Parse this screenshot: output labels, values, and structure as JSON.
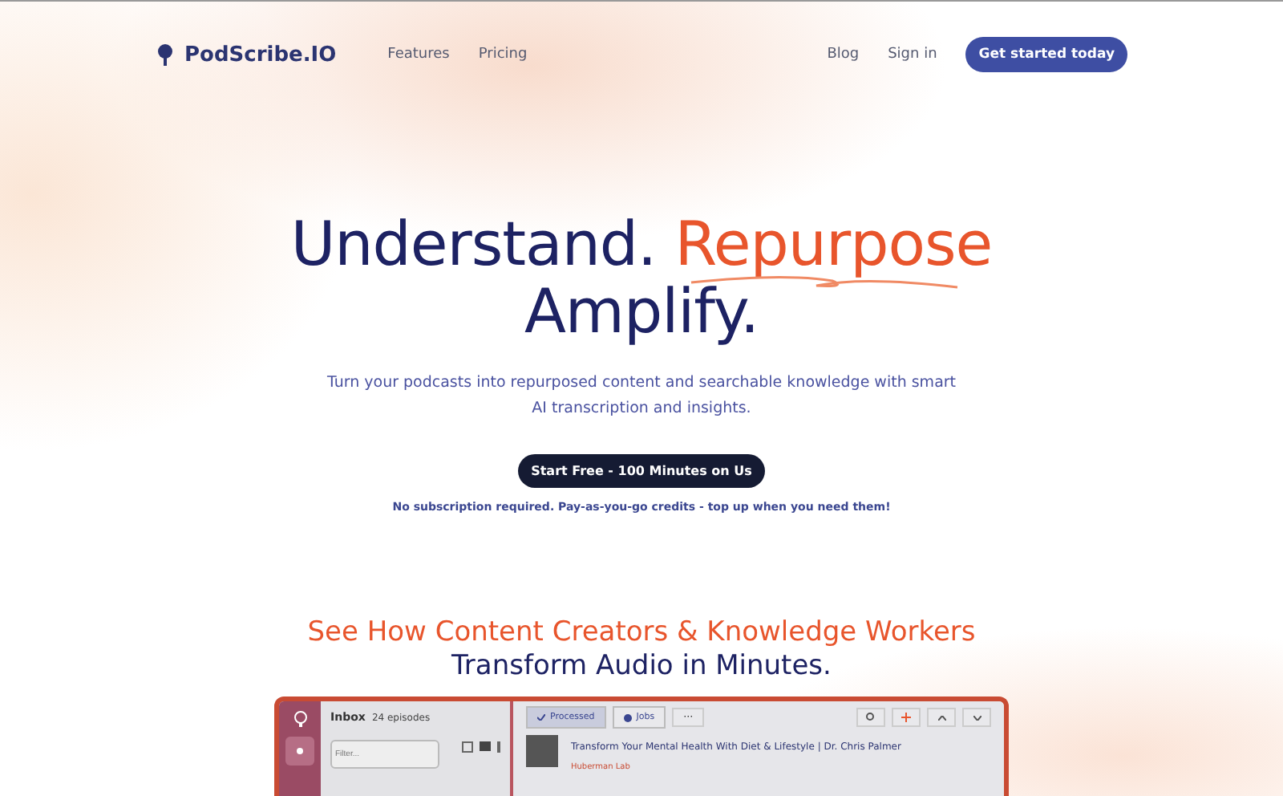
{
  "nav": {
    "brand": "PodScribe.IO",
    "links": [
      "Features",
      "Pricing"
    ],
    "right_links": [
      "Blog",
      "Sign in"
    ],
    "cta": "Get started today"
  },
  "hero": {
    "title_start": "Understand.",
    "title_accent": "Repurpose",
    "title_end": "Amplify.",
    "subtitle": "Turn your podcasts into repurposed content and searchable knowledge with smart AI transcription and insights.",
    "button": "Start Free - 100 Minutes on Us",
    "note": "No subscription required. Pay-as-you-go credits - top up when you need them!"
  },
  "section": {
    "heading_accent": "See How Content Creators & Knowledge Workers",
    "heading_rest": "Transform Audio in Minutes."
  },
  "app": {
    "inbox_title": "Inbox",
    "inbox_count": "24 episodes",
    "filter_placeholder": "Filter...",
    "tabs": [
      {
        "label": "Processed",
        "selected": true
      },
      {
        "label": "Jobs",
        "selected": false
      }
    ],
    "more": "···",
    "episode": {
      "title": "Transform Your Mental Health With Diet & Lifestyle | Dr. Chris Palmer",
      "show": "Huberman Lab"
    }
  }
}
